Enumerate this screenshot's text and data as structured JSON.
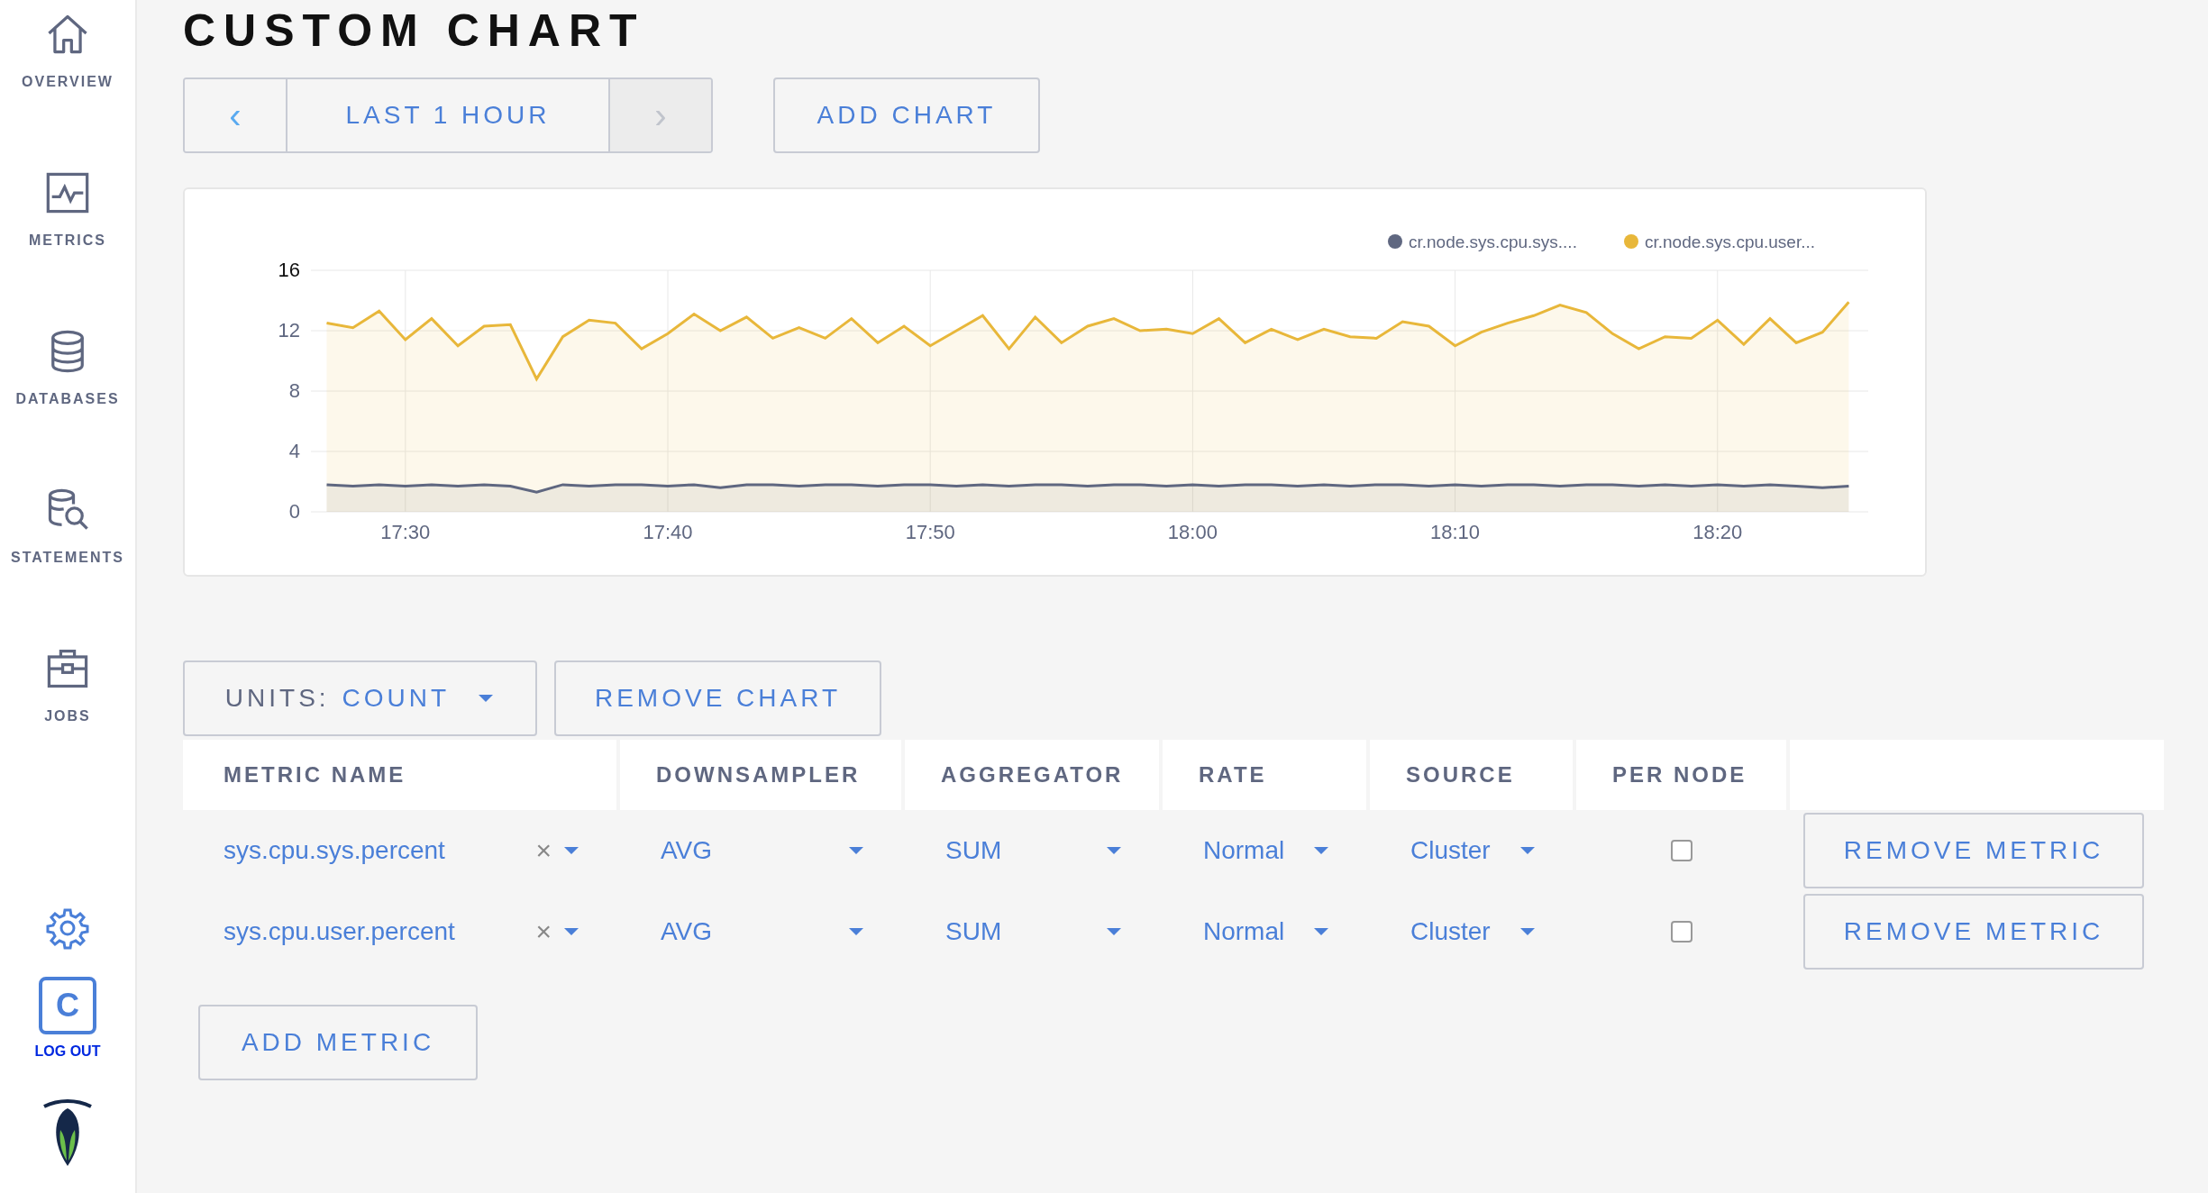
{
  "sidebar": {
    "items": [
      {
        "label": "OVERVIEW"
      },
      {
        "label": "METRICS"
      },
      {
        "label": "DATABASES"
      },
      {
        "label": "STATEMENTS"
      },
      {
        "label": "JOBS"
      }
    ],
    "user": {
      "initial": "C",
      "logout": "LOG OUT"
    }
  },
  "page": {
    "title": "CUSTOM CHART"
  },
  "time_range": {
    "prev": "‹",
    "label": "LAST 1 HOUR",
    "next": "›",
    "next_disabled": true
  },
  "add_chart": "ADD CHART",
  "chart_data": {
    "type": "area",
    "categories": [
      null,
      null,
      null,
      "17:30",
      null,
      null,
      null,
      null,
      null,
      null,
      null,
      null,
      null,
      "17:40",
      null,
      null,
      null,
      null,
      null,
      null,
      null,
      null,
      null,
      "17:50",
      null,
      null,
      null,
      null,
      null,
      null,
      null,
      null,
      null,
      "18:00",
      null,
      null,
      null,
      null,
      null,
      null,
      null,
      null,
      null,
      "18:10",
      null,
      null,
      null,
      null,
      null,
      null,
      null,
      null,
      null,
      "18:20",
      null,
      null,
      null,
      null,
      null
    ],
    "ylim": [
      0,
      16
    ],
    "yticks": [
      0,
      4,
      8,
      12,
      16
    ],
    "grid": true,
    "legend": "top-right",
    "series": [
      {
        "name": "cr.node.sys.cpu.sys....",
        "color": "#5f6780",
        "values": [
          1.8,
          1.7,
          1.8,
          1.7,
          1.8,
          1.7,
          1.8,
          1.7,
          1.3,
          1.8,
          1.7,
          1.8,
          1.8,
          1.7,
          1.8,
          1.6,
          1.8,
          1.8,
          1.7,
          1.8,
          1.8,
          1.7,
          1.8,
          1.8,
          1.7,
          1.8,
          1.7,
          1.8,
          1.8,
          1.7,
          1.8,
          1.8,
          1.7,
          1.8,
          1.7,
          1.8,
          1.8,
          1.7,
          1.8,
          1.7,
          1.8,
          1.8,
          1.7,
          1.8,
          1.7,
          1.8,
          1.8,
          1.7,
          1.8,
          1.8,
          1.7,
          1.8,
          1.7,
          1.8,
          1.7,
          1.8,
          1.7,
          1.6,
          1.7
        ]
      },
      {
        "name": "cr.node.sys.cpu.user...",
        "color": "#e8b73a",
        "values": [
          12.5,
          12.2,
          13.3,
          11.4,
          12.8,
          11.0,
          12.3,
          12.4,
          8.8,
          11.6,
          12.7,
          12.5,
          10.8,
          11.8,
          13.1,
          12.0,
          12.9,
          11.5,
          12.2,
          11.5,
          12.8,
          11.2,
          12.3,
          11.0,
          12.0,
          13.0,
          10.8,
          12.9,
          11.2,
          12.3,
          12.8,
          12.0,
          12.1,
          11.8,
          12.8,
          11.2,
          12.1,
          11.4,
          12.1,
          11.6,
          11.5,
          12.6,
          12.3,
          11.0,
          11.9,
          12.5,
          13.0,
          13.7,
          13.2,
          11.8,
          10.8,
          11.6,
          11.5,
          12.7,
          11.1,
          12.8,
          11.2,
          11.9,
          13.9
        ]
      }
    ]
  },
  "units": {
    "label": "UNITS:",
    "value": "COUNT"
  },
  "remove_chart": "REMOVE CHART",
  "table": {
    "columns": [
      "METRIC NAME",
      "DOWNSAMPLER",
      "AGGREGATOR",
      "RATE",
      "SOURCE",
      "PER NODE"
    ],
    "rows": [
      {
        "metric": "sys.cpu.sys.percent",
        "clear": "×",
        "downsampler": "AVG",
        "aggregator": "SUM",
        "rate": "Normal",
        "source": "Cluster",
        "per_node": false,
        "remove": "REMOVE METRIC"
      },
      {
        "metric": "sys.cpu.user.percent",
        "clear": "×",
        "downsampler": "AVG",
        "aggregator": "SUM",
        "rate": "Normal",
        "source": "Cluster",
        "per_node": false,
        "remove": "REMOVE METRIC"
      }
    ]
  },
  "add_metric": "ADD METRIC"
}
